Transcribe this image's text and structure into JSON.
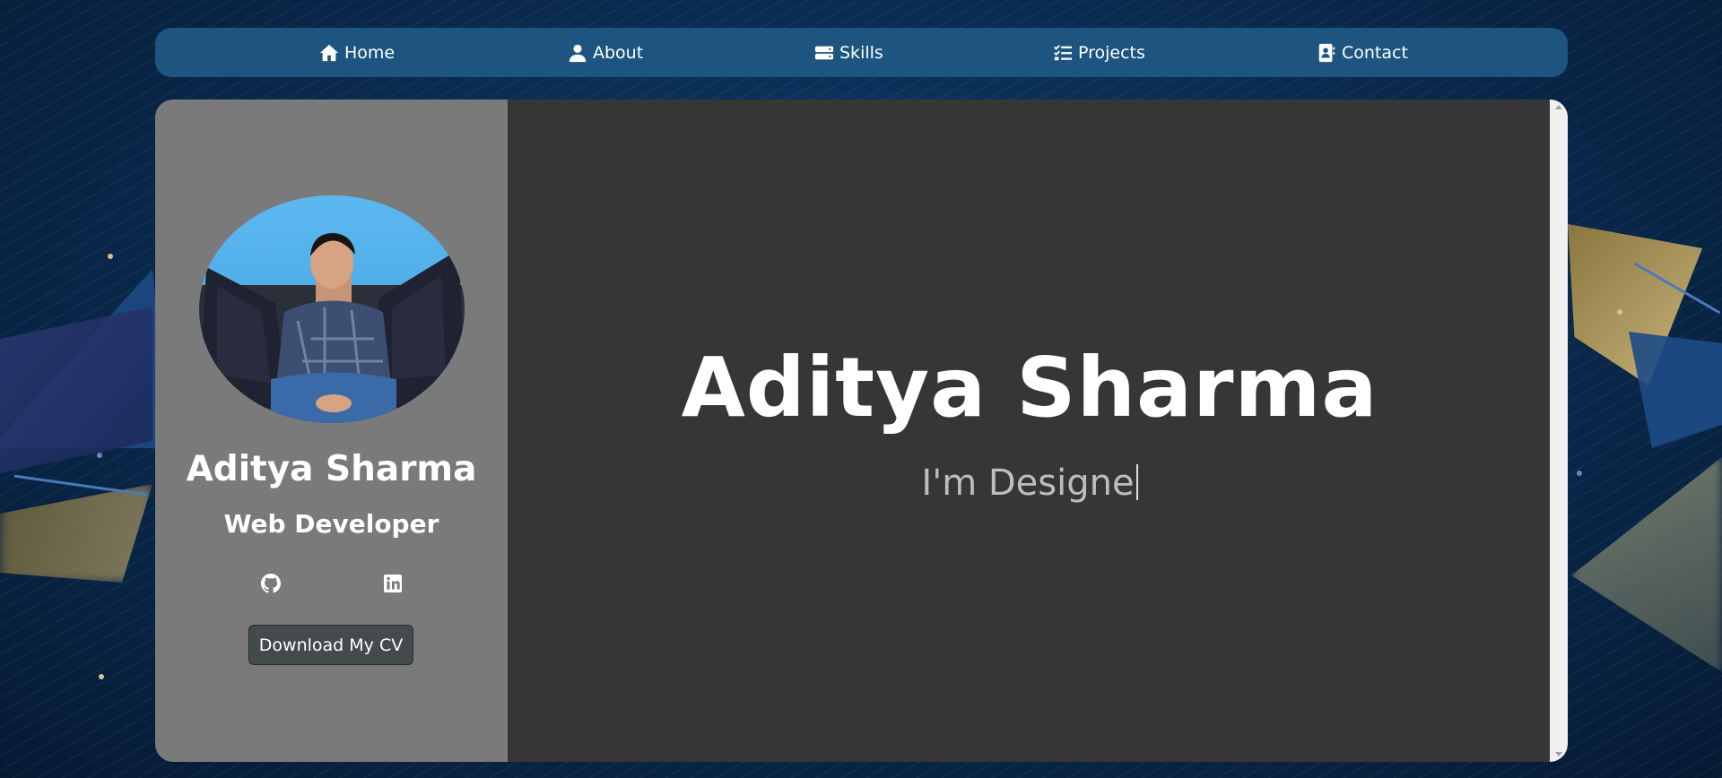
{
  "nav": {
    "items": [
      {
        "label": "Home",
        "icon": "home-icon"
      },
      {
        "label": "About",
        "icon": "user-icon"
      },
      {
        "label": "Skills",
        "icon": "server-icon"
      },
      {
        "label": "Projects",
        "icon": "tasks-icon"
      },
      {
        "label": "Contact",
        "icon": "address-book-icon"
      }
    ]
  },
  "profile": {
    "name": "Aditya Sharma",
    "role": "Web Developer",
    "social": [
      {
        "icon": "github-icon"
      },
      {
        "icon": "linkedin-icon"
      }
    ],
    "cv_button": "Download My CV"
  },
  "hero": {
    "name": "Aditya Sharma",
    "typed_text": "I'm Designe"
  },
  "colors": {
    "nav_bg": "#1d5580",
    "sidebar_bg": "#7a7a7a",
    "main_bg": "#363636",
    "page_bg": "#0a2c52"
  }
}
